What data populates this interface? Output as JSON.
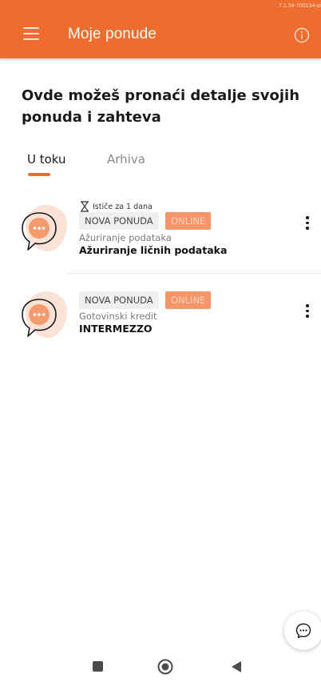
{
  "status": {
    "version_text": "7.1.34-700134-ui"
  },
  "appbar": {
    "title": "Moje ponude",
    "menu_icon": "hamburger-menu-icon",
    "info_icon": "info-icon",
    "color": "#ef6c2f"
  },
  "headline": "Ovde možeš pronaći detalje svojih ponuda i zahteva",
  "tabs": [
    {
      "label": "U toku",
      "active": true
    },
    {
      "label": "Arhiva",
      "active": false
    }
  ],
  "offers": [
    {
      "timer_icon": "hourglass-icon",
      "expiry": "Ističe za 1 dana",
      "badge": "NOVA PONUDA",
      "channel": "ONLINE",
      "category": "Ažuriranje podataka",
      "title": "Ažuriranje ličnih podataka",
      "menu_icon": "more-vertical-icon"
    },
    {
      "badge": "NOVA PONUDA",
      "channel": "ONLINE",
      "category": "Gotovinski kredit",
      "title": "INTERMEZZO",
      "menu_icon": "more-vertical-icon"
    }
  ],
  "chat_button": {
    "icon": "chat-bubble-icon"
  },
  "system_nav": {
    "icons": [
      "recent-apps-icon",
      "home-icon",
      "back-icon"
    ]
  }
}
